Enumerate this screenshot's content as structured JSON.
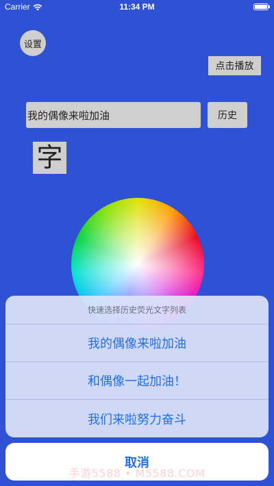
{
  "status_bar": {
    "carrier": "Carrier",
    "time": "11:34 PM",
    "wifi_icon": "wifi-icon",
    "battery_icon": "battery-icon"
  },
  "main": {
    "settings_label": "设置",
    "play_label": "点击播放",
    "input_value": "我的偶像来啦加油",
    "history_label": "历史",
    "font_char": "字",
    "color_wheel": "color-wheel"
  },
  "action_sheet": {
    "title": "快速选择历史荧光文字列表",
    "options": [
      "我的偶像来啦加油",
      "和偶像一起加油！",
      "我们来啦努力奋斗"
    ],
    "cancel_label": "取消"
  },
  "watermark": "手游5588 • M5588.COM",
  "colors": {
    "background": "#2f52d4",
    "accent": "#1f6fe8",
    "control_gray": "#cfcfcf"
  }
}
